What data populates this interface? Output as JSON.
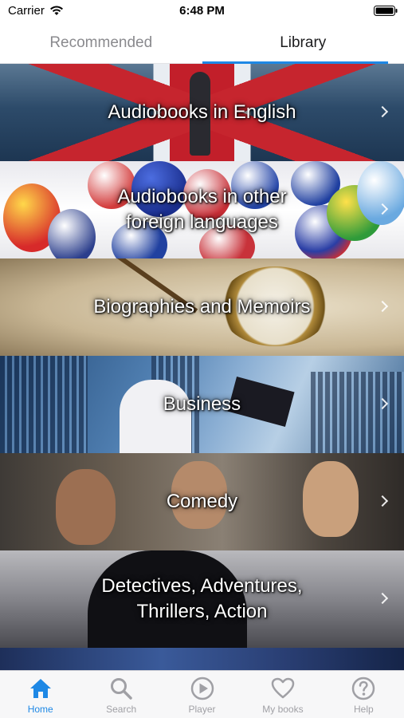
{
  "status_bar": {
    "carrier": "Carrier",
    "time": "6:48 PM",
    "icons": [
      "wifi-icon",
      "battery-icon"
    ]
  },
  "top_tabs": [
    {
      "label": "Recommended",
      "active": false
    },
    {
      "label": "Library",
      "active": true
    }
  ],
  "categories": [
    {
      "title": "Audiobooks in English"
    },
    {
      "title": "Audiobooks in other\nforeign languages"
    },
    {
      "title": "Biographies and Memoirs"
    },
    {
      "title": "Business"
    },
    {
      "title": "Comedy"
    },
    {
      "title": "Detectives, Adventures,\nThrillers, Action"
    }
  ],
  "bottom_tabs": [
    {
      "label": "Home",
      "icon": "home-icon",
      "active": true
    },
    {
      "label": "Search",
      "icon": "search-icon",
      "active": false
    },
    {
      "label": "Player",
      "icon": "play-icon",
      "active": false
    },
    {
      "label": "My books",
      "icon": "heart-icon",
      "active": false
    },
    {
      "label": "Help",
      "icon": "help-icon",
      "active": false
    }
  ],
  "colors": {
    "accent": "#1e88e5",
    "inactive": "#a0a0a5"
  }
}
